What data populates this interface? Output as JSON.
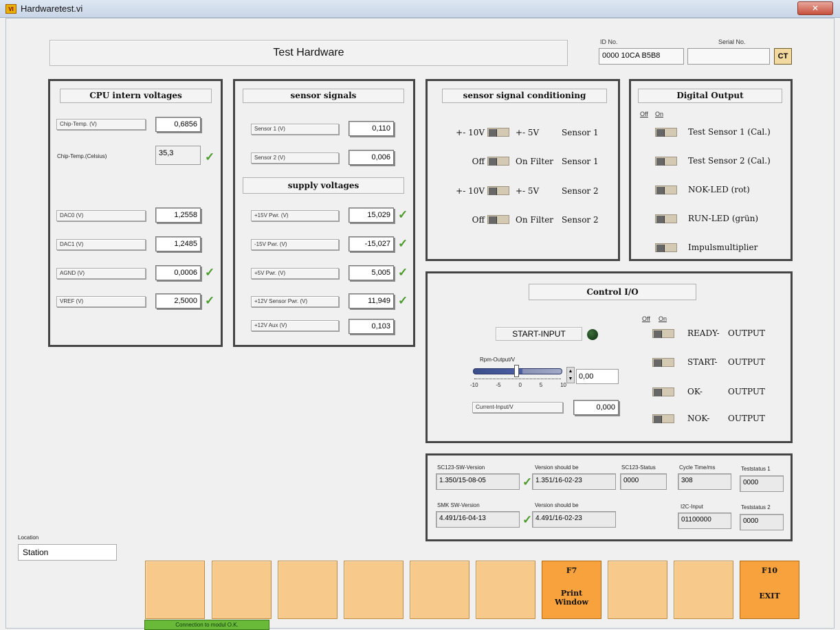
{
  "window": {
    "title": "Hardwaretest.vi",
    "close": "✕"
  },
  "header": {
    "title": "Test Hardware",
    "id_label": "ID No.",
    "id_value": "0000 10CA B5B8",
    "serial_label": "Serial No.",
    "serial_value": "",
    "ct_label": "CT"
  },
  "cpu": {
    "title": "CPU intern voltages",
    "rows": [
      {
        "label": "Chip-Temp. (V)",
        "value": "0,6856"
      },
      {
        "label": "Chip-Temp.(Celsius)",
        "value": "35,3"
      },
      {
        "label": "DAC0 (V)",
        "value": "1,2558"
      },
      {
        "label": "DAC1 (V)",
        "value": "1,2485"
      },
      {
        "label": "AGND (V)",
        "value": "0,0006"
      },
      {
        "label": "VREF (V)",
        "value": "2,5000"
      }
    ]
  },
  "sensors": {
    "title": "sensor signals",
    "rows": [
      {
        "label": "Sensor 1 (V)",
        "value": "0,110"
      },
      {
        "label": "Sensor 2 (V)",
        "value": "0,006"
      }
    ],
    "supply_title": "supply voltages",
    "supply": [
      {
        "label": "+15V Pwr. (V)",
        "value": "15,029"
      },
      {
        "label": "-15V Pwr. (V)",
        "value": "-15,027"
      },
      {
        "label": "+5V Pwr. (V)",
        "value": "5,005"
      },
      {
        "label": "+12V Sensor Pwr. (V)",
        "value": "11,949"
      },
      {
        "label": "+12V Aux (V)",
        "value": "0,103"
      }
    ]
  },
  "conditioning": {
    "title": "sensor signal conditioning",
    "rows": [
      {
        "left": "+- 10V",
        "right": "+- 5V",
        "name": "Sensor 1"
      },
      {
        "left": "Off",
        "right": "On  Filter",
        "name": "Sensor 1"
      },
      {
        "left": "+- 10V",
        "right": "+- 5V",
        "name": "Sensor 2"
      },
      {
        "left": "Off",
        "right": "On  Filter",
        "name": "Sensor 2"
      }
    ]
  },
  "digital": {
    "title": "Digital Output",
    "off": "Off",
    "on": "On",
    "items": [
      "Test Sensor 1 (Cal.)",
      "Test Sensor 2 (Cal.)",
      "NOK-LED (rot)",
      "RUN-LED (grün)",
      "Impulsmultiplier"
    ]
  },
  "control": {
    "title": "Control I/O",
    "start_input": "START-INPUT",
    "rpm_label": "Rpm-Output/V",
    "scale": [
      "-10",
      "-5",
      "0",
      "5",
      "10"
    ],
    "rpm_value": "0,00",
    "current_label": "Current-Input/V",
    "current_value": "0,000",
    "off": "Off",
    "on": "On",
    "outputs": [
      {
        "a": "READY-",
        "b": "OUTPUT"
      },
      {
        "a": "START-",
        "b": "OUTPUT"
      },
      {
        "a": "OK-",
        "b": "OUTPUT"
      },
      {
        "a": "NOK-",
        "b": "OUTPUT"
      }
    ]
  },
  "status": {
    "sc_sw_label": "SC123-SW-Version",
    "sc_sw_value": "1.350/15-08-05",
    "should1_label": "Version should be",
    "should1_value": "1.351/16-02-23",
    "sc_status_label": "SC123-Status",
    "sc_status_value": "0000",
    "cycle_label": "Cycle Time/ms",
    "cycle_value": "308",
    "ts1_label": "Teststatus 1",
    "ts1_value": "0000",
    "smk_label": "SMK SW-Version",
    "smk_value": "4.491/16-04-13",
    "should2_label": "Version should be",
    "should2_value": "4.491/16-02-23",
    "i2c_label": "I2C-Input",
    "i2c_value": "01100000",
    "ts2_label": "Teststatus 2",
    "ts2_value": "0000"
  },
  "location": {
    "label": "Location",
    "value": "Station"
  },
  "fbuttons": {
    "f7_key": "F7",
    "f7_line1": "Print",
    "f7_line2": "Window",
    "f10_key": "F10",
    "f10_label": "EXIT"
  },
  "statusbar": {
    "text": "Connection to modul O.K."
  }
}
